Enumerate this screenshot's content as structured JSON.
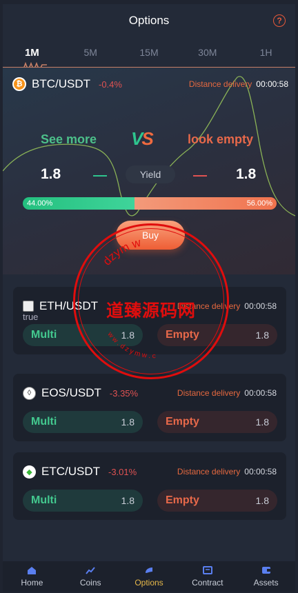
{
  "header": {
    "title": "Options",
    "help_icon": "?"
  },
  "tabs": [
    {
      "label": "1M",
      "active": true
    },
    {
      "label": "5M",
      "active": false
    },
    {
      "label": "15M",
      "active": false
    },
    {
      "label": "30M",
      "active": false
    },
    {
      "label": "1H",
      "active": false
    }
  ],
  "hero": {
    "pair": "BTC/USDT",
    "change": "-0.4%",
    "delivery_label": "Distance delivery",
    "timer": "00:00:58",
    "see_more": "See more",
    "look_empty": "look empty",
    "vs_v": "V",
    "vs_s": "S",
    "yield_left": "1.8",
    "yield_right": "1.8",
    "yield_label": "Yield",
    "long_pct_text": "44.00%",
    "short_pct_text": "56.00%",
    "long_fraction": 0.44,
    "buy_label": "Buy"
  },
  "markets": [
    {
      "pair": "ETH/USDT",
      "change": "",
      "icon": "eth-image-broken",
      "icon_alt": "true",
      "delivery_label": "Distance delivery",
      "timer": "00:00:58",
      "multi_label": "Multi",
      "multi_value": "1.8",
      "empty_label": "Empty",
      "empty_value": "1.8"
    },
    {
      "pair": "EOS/USDT",
      "change": "-3.35%",
      "icon": "eos-icon",
      "delivery_label": "Distance delivery",
      "timer": "00:00:58",
      "multi_label": "Multi",
      "multi_value": "1.8",
      "empty_label": "Empty",
      "empty_value": "1.8"
    },
    {
      "pair": "ETC/USDT",
      "change": "-3.01%",
      "icon": "etc-icon",
      "delivery_label": "Distance delivery",
      "timer": "00:00:58",
      "multi_label": "Multi",
      "multi_value": "1.8",
      "empty_label": "Empty",
      "empty_value": "1.8"
    }
  ],
  "watermark": {
    "text_cn": "道臻源码网",
    "text_top": "dzym w",
    "text_bottom": "w w . d z y m w . c"
  },
  "nav": [
    {
      "label": "Home",
      "icon": "home-icon",
      "active": false
    },
    {
      "label": "Coins",
      "icon": "coins-icon",
      "active": false
    },
    {
      "label": "Options",
      "icon": "options-icon",
      "active": true
    },
    {
      "label": "Contract",
      "icon": "contract-icon",
      "active": false
    },
    {
      "label": "Assets",
      "icon": "assets-icon",
      "active": false
    }
  ],
  "colors": {
    "accent_green": "#2ec58e",
    "accent_red": "#e05252",
    "accent_orange": "#ee5e35",
    "nav_active": "#e7b94a"
  }
}
